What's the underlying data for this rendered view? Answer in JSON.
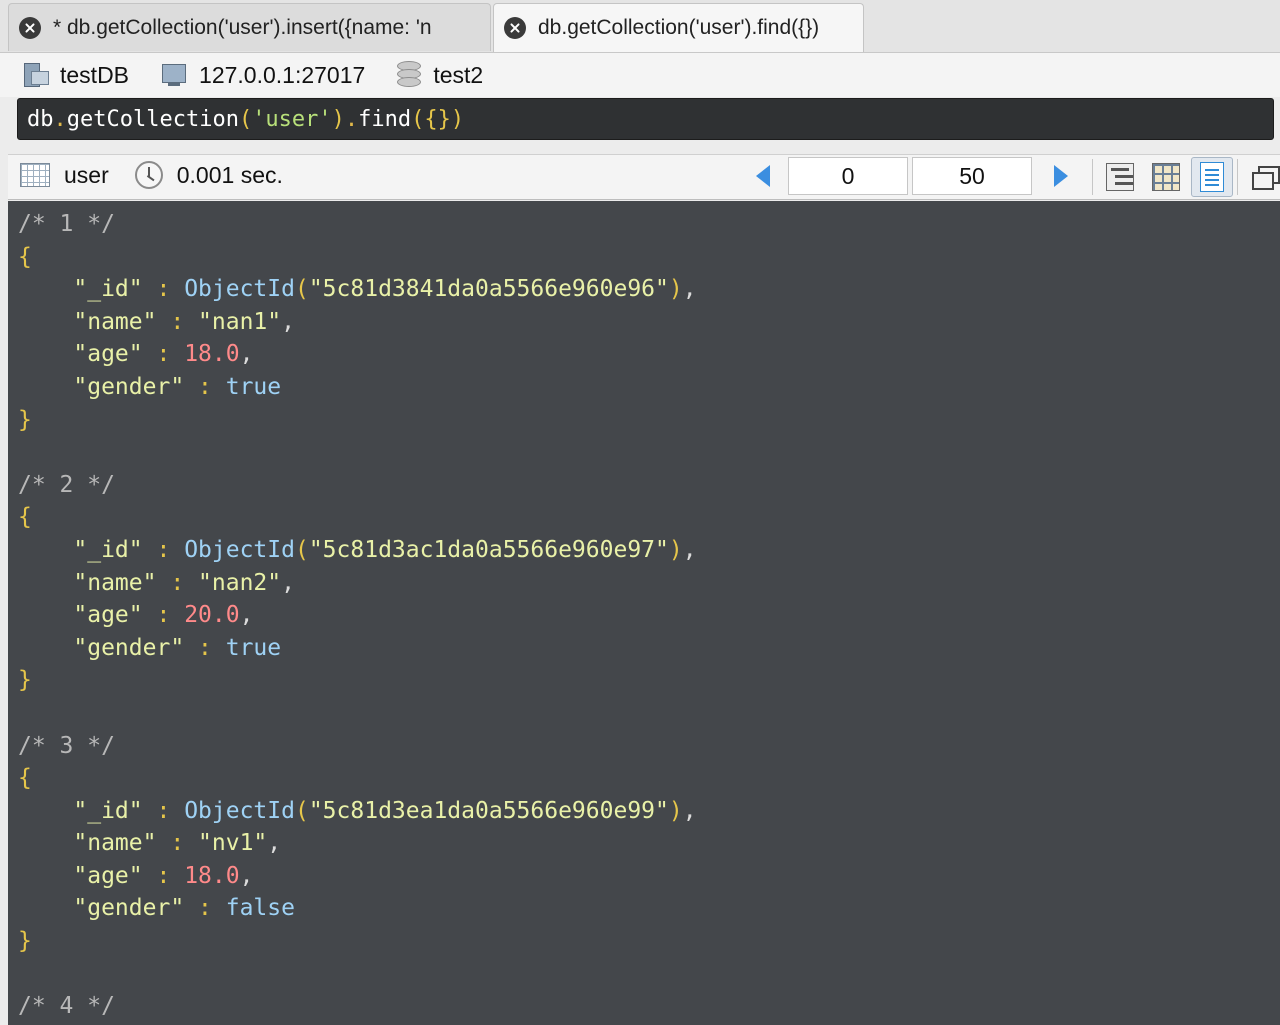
{
  "tabs": [
    {
      "label": "* db.getCollection('user').insert({name: 'n",
      "active": false
    },
    {
      "label": "db.getCollection('user').find({})",
      "active": true
    }
  ],
  "connection": {
    "name": "testDB",
    "host": "127.0.0.1:27017",
    "database": "test2"
  },
  "query": {
    "obj": "db",
    "fn": "getCollection",
    "collection": "'user'",
    "method": "find",
    "args": "{}"
  },
  "result_bar": {
    "collection": "user",
    "time": "0.001 sec.",
    "skip": "0",
    "limit": "50"
  },
  "documents": [
    {
      "index": "/* 1 */",
      "id": "\"5c81d3841da0a5566e960e96\"",
      "name": "\"nan1\"",
      "age": "18.0",
      "gender": "true"
    },
    {
      "index": "/* 2 */",
      "id": "\"5c81d3ac1da0a5566e960e97\"",
      "name": "\"nan2\"",
      "age": "20.0",
      "gender": "true"
    },
    {
      "index": "/* 3 */",
      "id": "\"5c81d3ea1da0a5566e960e99\"",
      "name": "\"nv1\"",
      "age": "18.0",
      "gender": "false"
    },
    {
      "index": "/* 4 */"
    }
  ],
  "syntax": {
    "open_brace": "{",
    "close_brace": "}",
    "id_key": "\"_id\"",
    "name_key": "\"name\"",
    "age_key": "\"age\"",
    "gender_key": "\"gender\"",
    "colon": " : ",
    "objectid": "ObjectId",
    "lparen": "(",
    "rparen": ")",
    "comma": ","
  },
  "colors": {
    "results_bg": "#44474b",
    "editor_bg": "#2f3133",
    "brace": "#e6c64a",
    "number": "#ff8a8a",
    "keyword": "#9fd2f5",
    "string": "#e9f1a8",
    "nav_arrow": "#3b8ee0"
  }
}
